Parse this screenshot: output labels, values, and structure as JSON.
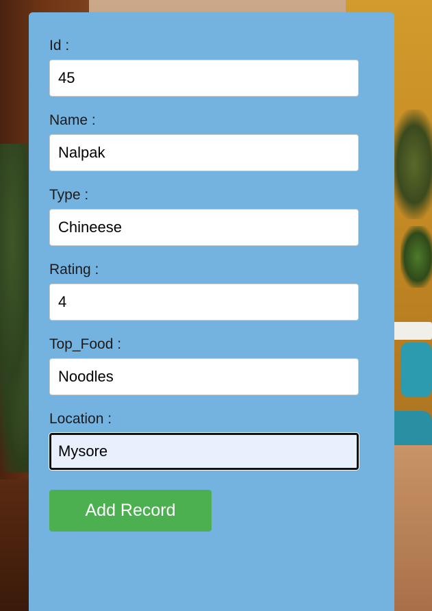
{
  "form": {
    "fields": [
      {
        "label": "Id :",
        "value": "45"
      },
      {
        "label": "Name :",
        "value": "Nalpak"
      },
      {
        "label": "Type :",
        "value": "Chineese"
      },
      {
        "label": "Rating :",
        "value": "4"
      },
      {
        "label": "Top_Food :",
        "value": "Noodles"
      },
      {
        "label": "Location :",
        "value": "Mysore"
      }
    ],
    "focused_field": "Location :",
    "submit_label": "Add Record"
  },
  "colors": {
    "card_background": "#74b3e0",
    "button_background": "#4caf50",
    "focused_input_background": "#e8f0fd"
  }
}
